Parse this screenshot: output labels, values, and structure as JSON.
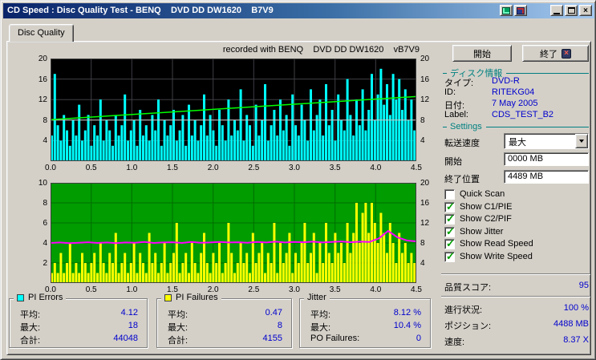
{
  "window": {
    "title": "CD Speed : Disc Quality Test - BENQ    DVD DD DW1620    B7V9"
  },
  "tab": {
    "label": "Disc Quality"
  },
  "icons": {
    "close_glyph": "×",
    "check_glyph": "✓",
    "dropdown": "chevron-down",
    "exit_glyph": "×"
  },
  "buttons": {
    "start": "開始",
    "exit": "終了"
  },
  "disc_info": {
    "header": "ディスク情報",
    "rows": [
      {
        "label": "タイプ:",
        "value": "DVD-R"
      },
      {
        "label": "ID:",
        "value": "RITEKG04"
      },
      {
        "label": "日付:",
        "value": "7 May 2005"
      },
      {
        "label": "Label:",
        "value": "CDS_TEST_B2"
      }
    ]
  },
  "settings": {
    "header": "Settings",
    "speed_label": "転送速度",
    "speed_value": "最大",
    "start_label": "開始",
    "start_value": "0000 MB",
    "end_label": "終了位置",
    "end_value": "4489 MB",
    "checkboxes": [
      {
        "label": "Quick Scan",
        "checked": false
      },
      {
        "label": "Show C1/PIE",
        "checked": true
      },
      {
        "label": "Show C2/PIF",
        "checked": true
      },
      {
        "label": "Show Jitter",
        "checked": true
      },
      {
        "label": "Show Read Speed",
        "checked": true
      },
      {
        "label": "Show Write Speed",
        "checked": true
      }
    ]
  },
  "status": {
    "quality_label": "品質スコア:",
    "quality_value": "95",
    "progress_label": "進行状況:",
    "progress_value": "100 %",
    "position_label": "ポジション:",
    "position_value": "4488 MB",
    "speed_label": "速度:",
    "speed_value": "8.37 X"
  },
  "legend": {
    "pi_errors": {
      "title": "PI Errors",
      "swatch": "#00ffff",
      "rows": [
        [
          "平均:",
          "4.12"
        ],
        [
          "最大:",
          "18"
        ],
        [
          "合計:",
          "44048"
        ]
      ]
    },
    "pi_failures": {
      "title": "PI Failures",
      "swatch": "#ffff00",
      "rows": [
        [
          "平均:",
          "0.47"
        ],
        [
          "最大:",
          "8"
        ],
        [
          "合計:",
          "4155"
        ]
      ]
    },
    "jitter": {
      "title": "Jitter",
      "rows": [
        [
          "平均:",
          "8.12 %"
        ],
        [
          "最大:",
          "10.4 %"
        ],
        [
          "PO Failures:",
          "0"
        ]
      ]
    }
  },
  "chart_data": [
    {
      "type": "bar",
      "title": "PI Errors over disc position",
      "annotation": "recorded with BENQ    DVD DD DW1620    vB7V9",
      "x_ticks": [
        "0.0",
        "0.5",
        "1.0",
        "1.5",
        "2.0",
        "2.5",
        "3.0",
        "3.5",
        "4.0",
        "4.5"
      ],
      "x_max": 4.5,
      "y_left": {
        "min": 0,
        "max": 20,
        "ticks": [
          20,
          16,
          12,
          8,
          4
        ]
      },
      "y_right": {
        "min": 0,
        "max": 20,
        "ticks": [
          20,
          16,
          12,
          8,
          4
        ]
      },
      "bg": "#000000",
      "grid": "#3f3f46",
      "legend_position": "none",
      "bars": {
        "name": "PI Errors",
        "color": "#00ffff",
        "axis": "left",
        "values": [
          5,
          17,
          7,
          4,
          9,
          6,
          3,
          8,
          5,
          11,
          4,
          6,
          9,
          3,
          7,
          5,
          12,
          4,
          8,
          6,
          3,
          9,
          5,
          7,
          13,
          4,
          6,
          8,
          3,
          10,
          5,
          7,
          4,
          9,
          6,
          12,
          3,
          8,
          5,
          7,
          10,
          4,
          6,
          9,
          3,
          11,
          5,
          8,
          4,
          7,
          13,
          5,
          9,
          6,
          3,
          10,
          7,
          4,
          12,
          5,
          8,
          6,
          14,
          4,
          9,
          7,
          3,
          11,
          5,
          8,
          15,
          4,
          7,
          10,
          5,
          12,
          6,
          9,
          3,
          13,
          7,
          5,
          11,
          8,
          4,
          14,
          6,
          9,
          12,
          5,
          15,
          7,
          10,
          4,
          13,
          8,
          6,
          16,
          9,
          5,
          12,
          7,
          14,
          6,
          10,
          17,
          8,
          13,
          18,
          11,
          15,
          9,
          17,
          12,
          16,
          10,
          14,
          8,
          12,
          6
        ]
      },
      "lines": [
        {
          "name": "Read Speed",
          "color": "#c8c8c8",
          "width": 1,
          "axis": "left",
          "points": [
            [
              0,
              8
            ],
            [
              4.5,
              8
            ]
          ]
        },
        {
          "name": "Write Speed",
          "color": "#00ff00",
          "width": 1.5,
          "axis": "left",
          "points": [
            [
              0,
              8.1
            ],
            [
              4.5,
              12.6
            ]
          ]
        }
      ]
    },
    {
      "type": "bar",
      "title": "PI Failures and Jitter over disc position",
      "x_ticks": [
        "0.0",
        "0.5",
        "1.0",
        "1.5",
        "2.0",
        "2.5",
        "3.0",
        "3.5",
        "4.0",
        "4.5"
      ],
      "x_max": 4.5,
      "y_left": {
        "min": 0,
        "max": 10,
        "ticks": [
          10,
          8,
          6,
          4,
          2
        ]
      },
      "y_right": {
        "min": 0,
        "max": 20,
        "ticks": [
          20,
          16,
          12,
          8,
          4
        ]
      },
      "bg": "#009c00",
      "grid": "#006e00",
      "legend_position": "none",
      "bars": {
        "name": "PI Failures",
        "color": "#ffff00",
        "axis": "left",
        "values": [
          1,
          2,
          1,
          3,
          1,
          2,
          4,
          1,
          2,
          1,
          3,
          2,
          1,
          2,
          3,
          1,
          4,
          2,
          1,
          3,
          2,
          5,
          1,
          2,
          3,
          1,
          2,
          4,
          1,
          3,
          2,
          1,
          5,
          2,
          3,
          1,
          2,
          4,
          1,
          2,
          3,
          6,
          1,
          2,
          3,
          1,
          4,
          2,
          1,
          3,
          5,
          2,
          1,
          3,
          2,
          4,
          1,
          2,
          6,
          3,
          1,
          2,
          4,
          2,
          3,
          1,
          5,
          2,
          3,
          4,
          1,
          3,
          2,
          6,
          1,
          4,
          2,
          3,
          5,
          1,
          3,
          2,
          4,
          6,
          2,
          3,
          5,
          1,
          4,
          2,
          6,
          3,
          2,
          5,
          3,
          4,
          2,
          6,
          3,
          5,
          8,
          4,
          7,
          8,
          5,
          8,
          6,
          4,
          7,
          5,
          3,
          6,
          4,
          2,
          5,
          3,
          4,
          2,
          3,
          2
        ]
      },
      "lines": [
        {
          "name": "Jitter",
          "color": "#ff00ff",
          "width": 2,
          "axis": "right",
          "values": [
            8.0,
            8.1,
            7.95,
            8.05,
            8.15,
            8.0,
            8.1,
            7.95,
            8.1,
            8.05,
            8.2,
            8.0,
            8.1,
            8.15,
            8.0,
            8.2,
            8.05,
            8.1,
            8.2,
            8.1,
            8.15,
            8.05,
            8.2,
            8.1,
            8.25,
            8.1,
            8.2,
            8.15,
            8.25,
            8.1,
            8.2,
            8.3,
            8.15,
            8.25,
            8.2,
            8.9,
            10.4,
            9.1,
            8.5,
            8.3
          ]
        }
      ]
    }
  ]
}
